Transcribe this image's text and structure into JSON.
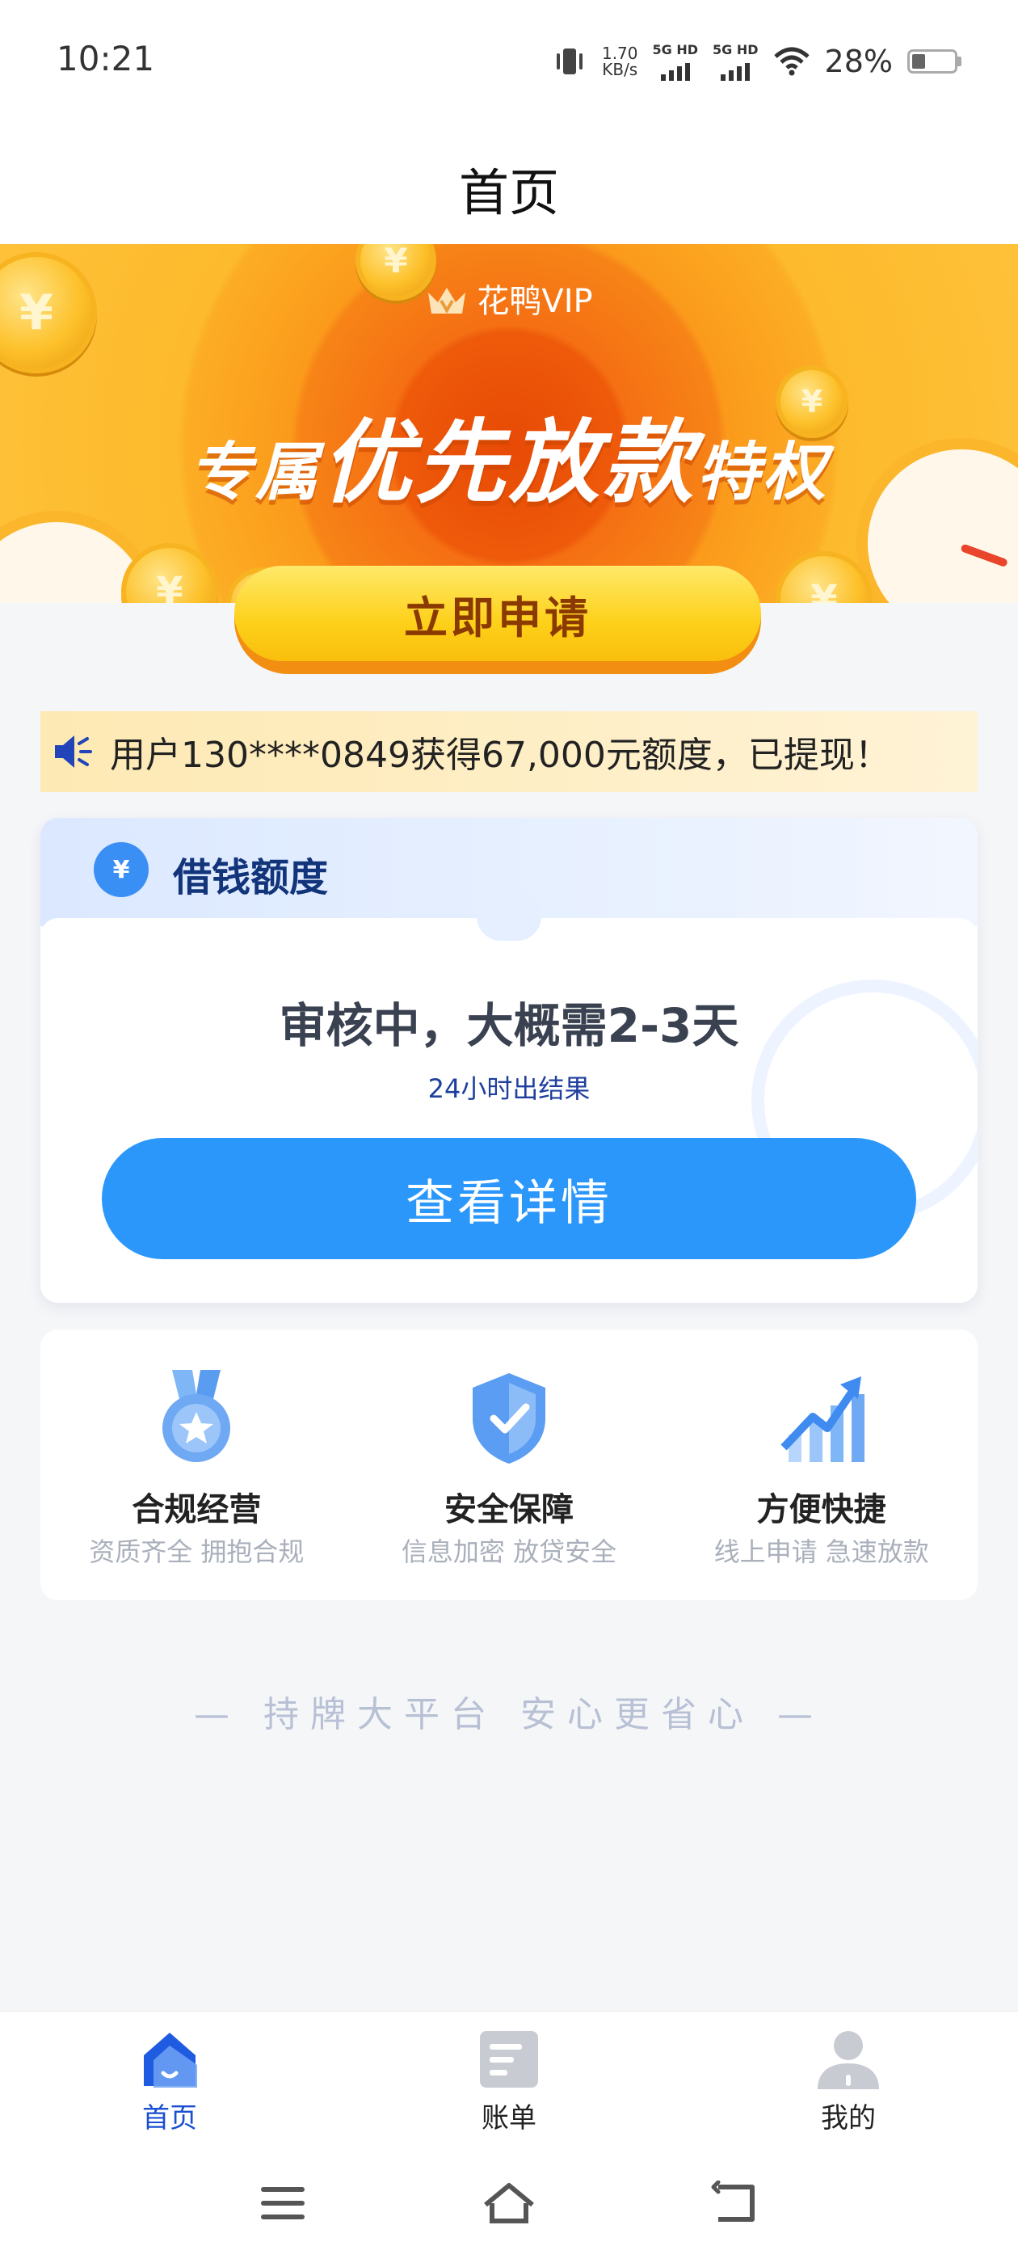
{
  "status_bar": {
    "time": "10:21",
    "net_speed_value": "1.70",
    "net_speed_unit": "KB/s",
    "sim1": "5G HD",
    "sim2": "5G HD",
    "battery": "28%"
  },
  "header": {
    "title": "首页"
  },
  "banner": {
    "vip_label": "花鸭VIP",
    "slogan_prefix": "专属",
    "slogan_main": "优先放款",
    "slogan_suffix": "特权",
    "coin_symbol": "¥"
  },
  "apply_button": {
    "label": "立即申请"
  },
  "notice": {
    "text": "用户130****0849获得67,000元额度，已提现！"
  },
  "loan_card": {
    "title": "借钱额度",
    "bag_symbol": "¥",
    "status": "审核中，大概需2-3天",
    "sub": "24小时出结果",
    "detail_button": "查看详情"
  },
  "features": [
    {
      "name": "合规经营",
      "desc": "资质齐全 拥抱合规",
      "icon": "medal-icon"
    },
    {
      "name": "安全保障",
      "desc": "信息加密 放贷安全",
      "icon": "shield-check-icon"
    },
    {
      "name": "方便快捷",
      "desc": "线上申请 急速放款",
      "icon": "chart-arrow-icon"
    }
  ],
  "tagline": "— 持牌大平台 安心更省心 —",
  "tabs": [
    {
      "label": "首页",
      "icon": "home-icon",
      "active": true
    },
    {
      "label": "账单",
      "icon": "bill-icon",
      "active": false
    },
    {
      "label": "我的",
      "icon": "user-icon",
      "active": false
    }
  ],
  "colors": {
    "primary_blue": "#2b97fb",
    "banner_orange": "#f78417",
    "apply_yellow": "#fdd01a",
    "active_tab": "#1a4fd1"
  }
}
